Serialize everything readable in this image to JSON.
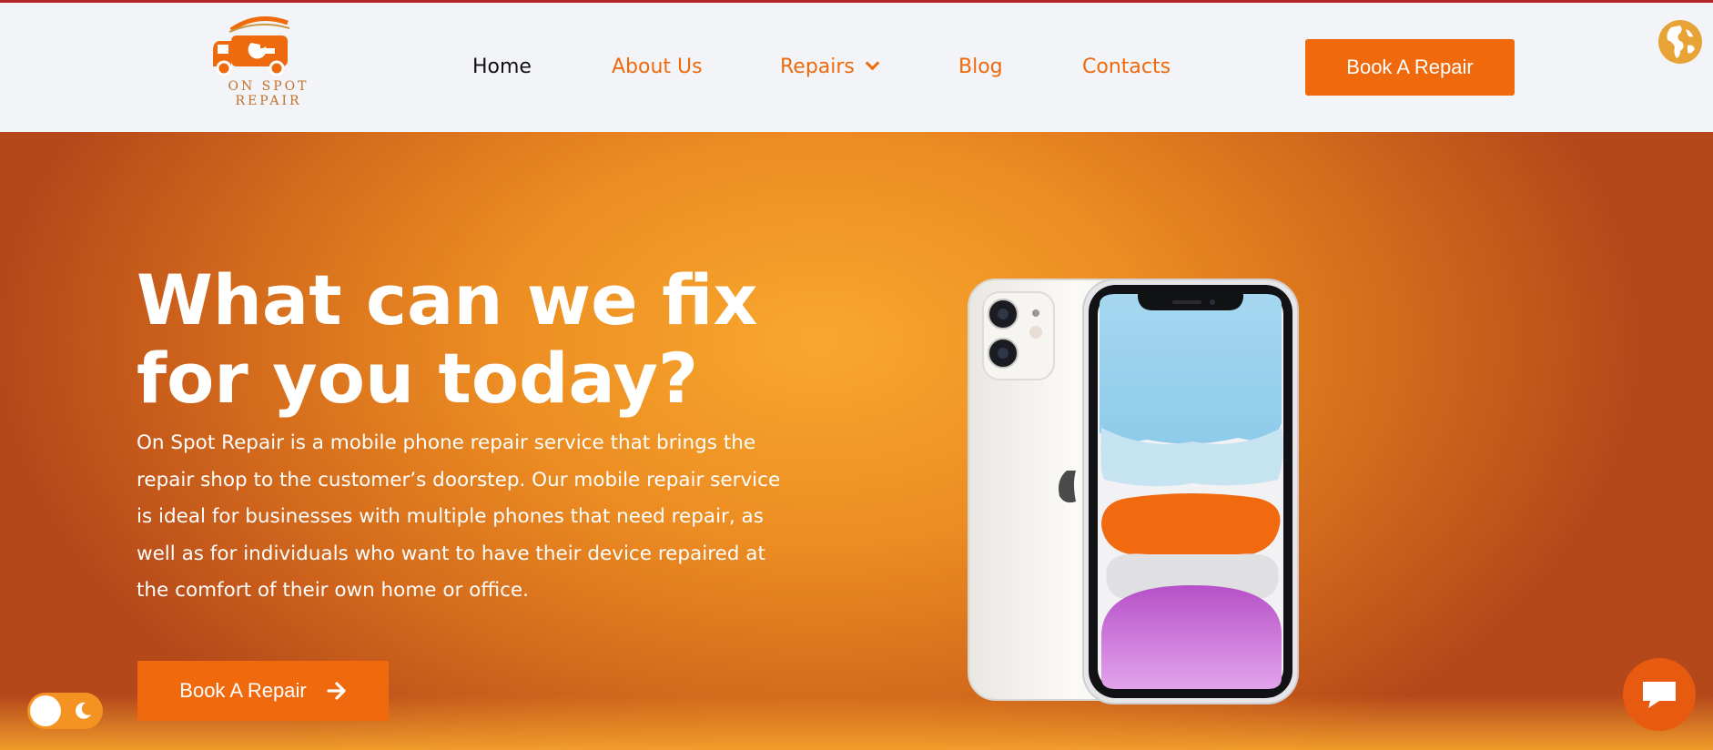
{
  "brand": {
    "name": "ON SPOT REPAIR",
    "logo_icon": "van-wrench-logo"
  },
  "nav": {
    "items": [
      {
        "label": "Home",
        "active": true
      },
      {
        "label": "About Us"
      },
      {
        "label": "Repairs",
        "has_dropdown": true
      },
      {
        "label": "Blog"
      },
      {
        "label": "Contacts"
      }
    ],
    "cta_label": "Book A Repair"
  },
  "hero": {
    "title_line1": "What can we fix",
    "title_line2": "for you today?",
    "description": "On Spot Repair is a mobile phone repair service that brings the repair shop to the customer’s doorstep. Our mobile repair service is ideal for businesses with multiple phones that need repair, as well as for individuals who want to have their device repaired at the comfort of their own home or office.",
    "cta_label": "Book A Repair",
    "cta_icon": "arrow-right-icon",
    "image": "phone-image"
  },
  "widgets": {
    "language_icon": "globe-icon",
    "theme_toggle_icon": "moon-icon",
    "chat_icon": "chat-bubble-icon"
  },
  "colors": {
    "accent": "#f0690d",
    "hero_center": "#f8a82e",
    "hero_edge": "#b5481a",
    "top_border": "#b3262b"
  }
}
